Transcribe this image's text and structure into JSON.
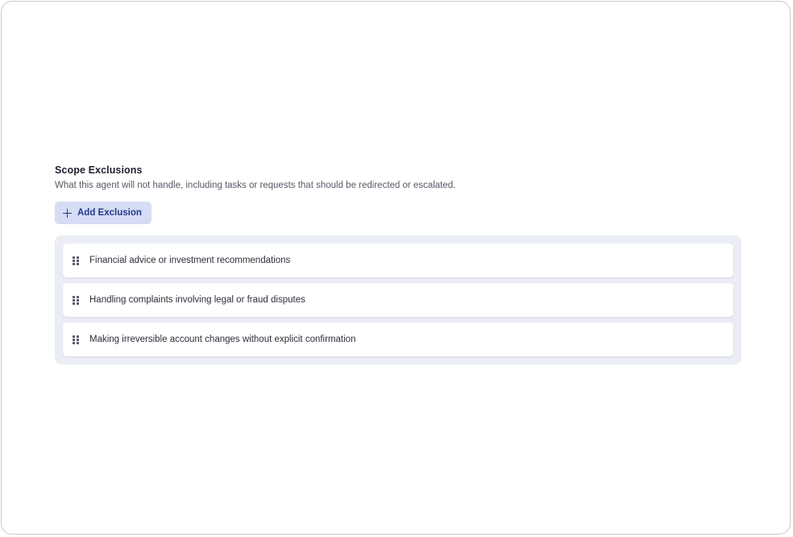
{
  "section": {
    "title": "Scope Exclusions",
    "description": "What this agent will not handle, including tasks or requests that should be redirected or escalated."
  },
  "add_button": {
    "label": "Add Exclusion",
    "icon": "plus-icon"
  },
  "exclusions": [
    {
      "text": "Financial advice or investment recommendations",
      "icon": "drag-handle-icon"
    },
    {
      "text": "Handling complaints involving legal or fraud disputes",
      "icon": "drag-handle-icon"
    },
    {
      "text": "Making irreversible account changes without explicit confirmation",
      "icon": "drag-handle-icon"
    }
  ],
  "colors": {
    "accent": "#233a8c",
    "button_bg": "#d7dcf5",
    "panel_bg": "#eaedf4"
  }
}
